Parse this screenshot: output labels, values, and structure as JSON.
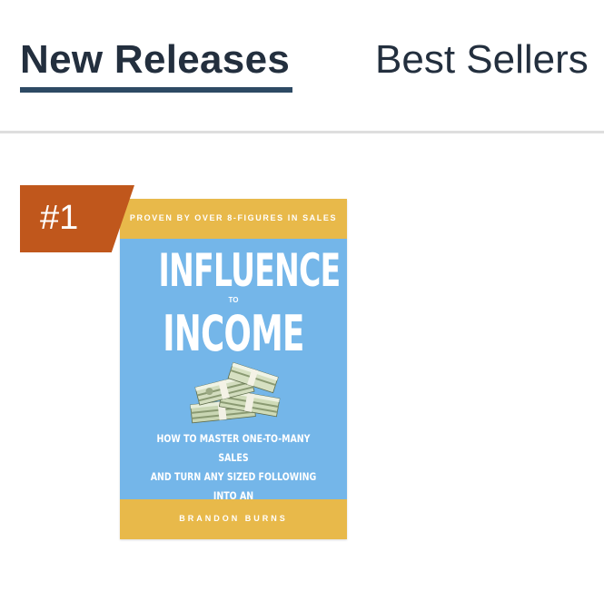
{
  "tabs": {
    "active_label": "New Releases",
    "inactive_label": "Best Sellers"
  },
  "product": {
    "rank": "#1",
    "cover": {
      "tagline": "PROVEN BY OVER 8-FIGURES IN SALES",
      "title_line_1": "INFLUENCE",
      "title_connector": "TO",
      "title_line_2": "INCOME",
      "subtitle": "HOW TO MASTER ONE-TO-MANY SALES\nAND TURN ANY SIZED FOLLOWING INTO AN\nAI-PROOF MONEY MACHINE",
      "author": "BRANDON BURNS",
      "image_icon": "money-stack-icon"
    }
  },
  "colors": {
    "tab_text": "#232f3e",
    "tab_underline": "#2d4a64",
    "divider": "#dedede",
    "rank_badge": "#c0571c",
    "cover_blue": "#74b6e9",
    "cover_gold": "#e8b94a"
  }
}
